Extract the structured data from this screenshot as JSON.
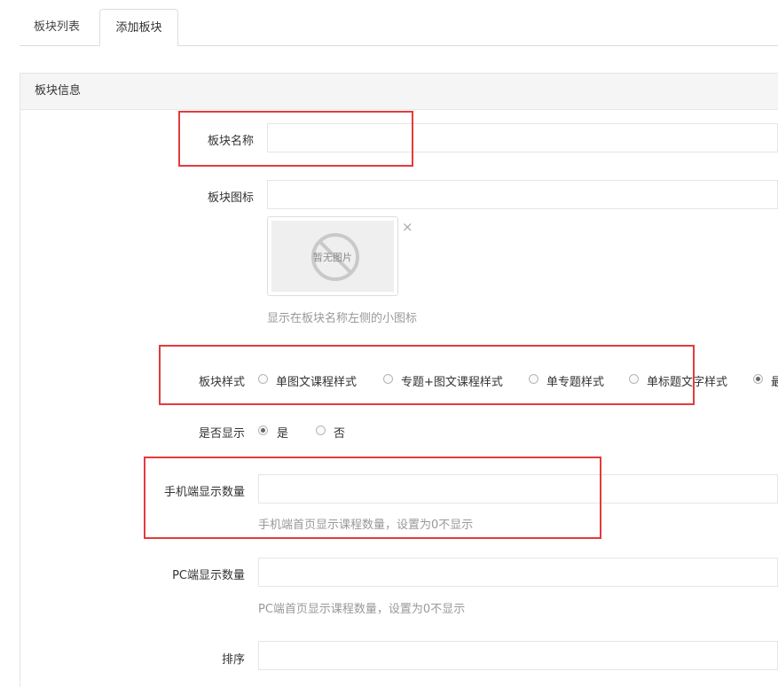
{
  "tabs": [
    {
      "label": "板块列表",
      "active": false
    },
    {
      "label": "添加板块",
      "active": true
    }
  ],
  "panel": {
    "title": "板块信息"
  },
  "form": {
    "name": {
      "label": "板块名称",
      "value": "",
      "placeholder": ""
    },
    "icon": {
      "label": "板块图标",
      "value": "",
      "no_image_text": "暂无图片",
      "remove_glyph": "×",
      "help": "显示在板块名称左侧的小图标"
    },
    "style": {
      "label": "板块样式",
      "options": [
        {
          "label": "单图文课程样式",
          "checked": false
        },
        {
          "label": "专题+图文课程样式",
          "checked": false
        },
        {
          "label": "单专题样式",
          "checked": false
        },
        {
          "label": "单标题文字样式",
          "checked": false
        },
        {
          "label": "最",
          "checked": true
        }
      ]
    },
    "visible": {
      "label": "是否显示",
      "options": [
        {
          "label": "是",
          "checked": true
        },
        {
          "label": "否",
          "checked": false
        }
      ]
    },
    "mobile_count": {
      "label": "手机端显示数量",
      "value": "",
      "help": "手机端首页显示课程数量，设置为0不显示"
    },
    "pc_count": {
      "label": "PC端显示数量",
      "value": "",
      "help": "PC端首页显示课程数量，设置为0不显示"
    },
    "sort": {
      "label": "排序",
      "value": ""
    }
  },
  "colors": {
    "annotation": "#e33b3b",
    "border": "#e5e5e5",
    "help_text": "#999999"
  },
  "icons": {
    "no_image": "no-image-icon",
    "remove": "close-icon"
  }
}
